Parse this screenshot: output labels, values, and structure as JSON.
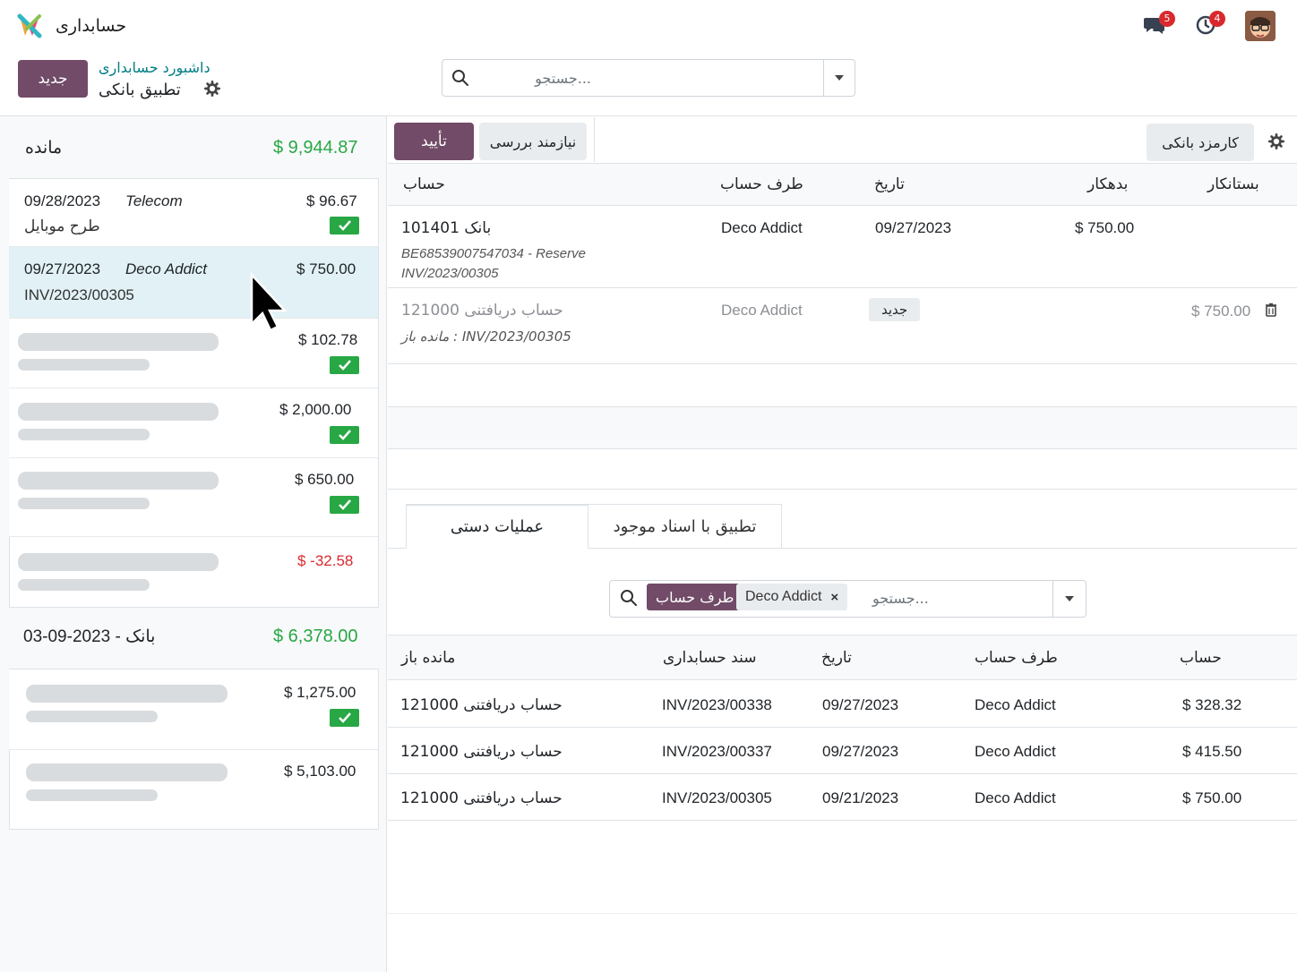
{
  "app": {
    "name": "حسابداری"
  },
  "header": {
    "chat_badge": "5",
    "activity_badge": "4"
  },
  "control": {
    "new_button": "جدید",
    "breadcrumb_parent": "داشبورد حسابداری",
    "breadcrumb_current": "تطبیق بانکی",
    "search_placeholder": "جستجو..."
  },
  "left": {
    "balance_label": "مانده",
    "balance_value": "$ 9,944.87",
    "lines": [
      {
        "date": "09/28/2023",
        "partner": "Telecom",
        "amount": "$ 96.67",
        "sub": "طرح موبایل"
      },
      {
        "date": "09/27/2023",
        "partner": "Deco Addict",
        "amount": "$ 750.00",
        "sub": "INV/2023/00305"
      },
      {
        "amount": "$ 102.78"
      },
      {
        "amount": "$ 2,000.00"
      },
      {
        "amount": "$ 650.00"
      },
      {
        "amount": "$ -32.58"
      }
    ],
    "statement_label": "بانک - 2023-09-03",
    "statement_value": "$ 6,378.00",
    "lines2": [
      {
        "amount": "$ 1,275.00"
      },
      {
        "amount": "$ 5,103.00"
      }
    ]
  },
  "right": {
    "validate_button": "تأیید",
    "to_check_button": "نیازمند بررسی",
    "bank_fees_button": "کارمزد بانکی",
    "table_headers": {
      "account": "حساب",
      "partner": "طرف حساب",
      "date": "تاریخ",
      "debit": "بدهکار",
      "credit": "بستانکار"
    },
    "row1": {
      "account": "101401 بانک",
      "sub1": "BE68539007547034 - Reserve",
      "sub2": "INV/2023/00305",
      "partner": "Deco Addict",
      "date": "09/27/2023",
      "debit": "$ 750.00"
    },
    "row2": {
      "account": "121000 حساب دریافتنی",
      "sub": "مانده باز : INV/2023/00305",
      "partner": "Deco Addict",
      "tag": "جدید",
      "credit": "$ 750.00"
    },
    "tabs": {
      "manual": "عملیات دستی",
      "match": "تطبیق با اسناد موجود"
    },
    "search2": {
      "facet_label": "طرف حساب",
      "facet_value": "Deco Addict",
      "placeholder": "جستجو..."
    },
    "match_headers": {
      "open_balance": "مانده باز",
      "journal_entry": "سند حسابداری",
      "date": "تاریخ",
      "partner": "طرف حساب",
      "account": "حساب"
    },
    "match_rows": [
      {
        "open_balance": "121000 حساب دریافتنی",
        "entry": "INV/2023/00338",
        "date": "09/27/2023",
        "partner": "Deco Addict",
        "amount": "$ 328.32"
      },
      {
        "open_balance": "121000 حساب دریافتنی",
        "entry": "INV/2023/00337",
        "date": "09/27/2023",
        "partner": "Deco Addict",
        "amount": "$ 415.50"
      },
      {
        "open_balance": "121000 حساب دریافتنی",
        "entry": "INV/2023/00305",
        "date": "09/21/2023",
        "partner": "Deco Addict",
        "amount": "$ 750.00"
      }
    ]
  }
}
